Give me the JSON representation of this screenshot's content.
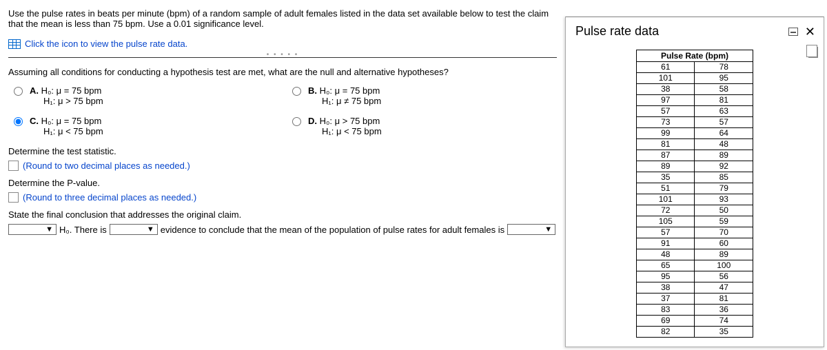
{
  "instruction": "Use the pulse rates in beats per minute (bpm) of a random sample of adult females listed in the data set available below to test the claim that the mean is less than 75 bpm. Use a 0.01 significance level.",
  "data_link_text": "Click the icon to view the pulse rate data.",
  "question_prompt": "Assuming all conditions for conducting a hypothesis test are met, what are the null and alternative hypotheses?",
  "choices": {
    "a": {
      "label": "A.",
      "h0": "H₀: μ = 75 bpm",
      "h1": "H₁: μ > 75 bpm"
    },
    "b": {
      "label": "B.",
      "h0": "H₀: μ = 75 bpm",
      "h1": "H₁: μ ≠ 75 bpm"
    },
    "c": {
      "label": "C.",
      "h0": "H₀: μ = 75 bpm",
      "h1": "H₁: μ < 75 bpm"
    },
    "d": {
      "label": "D.",
      "h0": "H₀: μ > 75 bpm",
      "h1": "H₁: μ < 75 bpm"
    }
  },
  "selected_choice": "c",
  "stat_prompt": "Determine the test statistic.",
  "stat_hint": "(Round to two decimal places as needed.)",
  "pval_prompt": "Determine the P-value.",
  "pval_hint": "(Round to three decimal places as needed.)",
  "conclusion_prompt": "State the final conclusion that addresses the original claim.",
  "conclusion": {
    "part2": "H₀. There is",
    "part4": "evidence to conclude that the mean of the population of pulse rates for adult females is"
  },
  "modal": {
    "title": "Pulse rate data",
    "table_header": "Pulse Rate (bpm)"
  },
  "chart_data": {
    "type": "table",
    "title": "Pulse Rate (bpm)",
    "rows": [
      [
        61,
        78
      ],
      [
        101,
        95
      ],
      [
        38,
        58
      ],
      [
        97,
        81
      ],
      [
        57,
        63
      ],
      [
        73,
        57
      ],
      [
        99,
        64
      ],
      [
        81,
        48
      ],
      [
        87,
        89
      ],
      [
        89,
        92
      ],
      [
        35,
        85
      ],
      [
        51,
        79
      ],
      [
        101,
        93
      ],
      [
        72,
        50
      ],
      [
        105,
        59
      ],
      [
        57,
        70
      ],
      [
        91,
        60
      ],
      [
        48,
        89
      ],
      [
        65,
        100
      ],
      [
        95,
        56
      ],
      [
        38,
        47
      ],
      [
        37,
        81
      ],
      [
        83,
        36
      ],
      [
        69,
        74
      ],
      [
        82,
        35
      ]
    ]
  }
}
